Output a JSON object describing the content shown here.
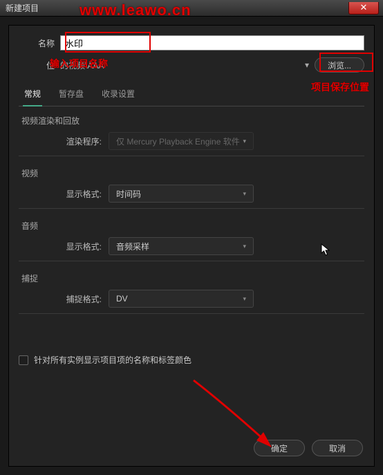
{
  "window": {
    "title": "新建项目",
    "close": "✕"
  },
  "watermark": "www.leawo.cn",
  "form": {
    "name_label": "名称",
    "name_value": "水印",
    "location_label": "位",
    "location_value": "的视频\\AAA",
    "browse": "浏览..."
  },
  "tabs": {
    "general": "常规",
    "scratch": "暂存盘",
    "ingest": "收录设置"
  },
  "sections": {
    "render": {
      "title": "视频渲染和回放",
      "renderer_label": "渲染程序:",
      "renderer_value": "仅 Mercury Playback Engine 软件"
    },
    "video": {
      "title": "视频",
      "format_label": "显示格式:",
      "format_value": "时间码"
    },
    "audio": {
      "title": "音频",
      "format_label": "显示格式:",
      "format_value": "音频采样"
    },
    "capture": {
      "title": "捕捉",
      "format_label": "捕捉格式:",
      "format_value": "DV"
    }
  },
  "checkbox_label": "针对所有实例显示项目项的名称和标签颜色",
  "footer": {
    "ok": "确定",
    "cancel": "取消"
  },
  "annotations": {
    "name_hint": "输入项目名称",
    "save_hint": "项目保存位置"
  }
}
